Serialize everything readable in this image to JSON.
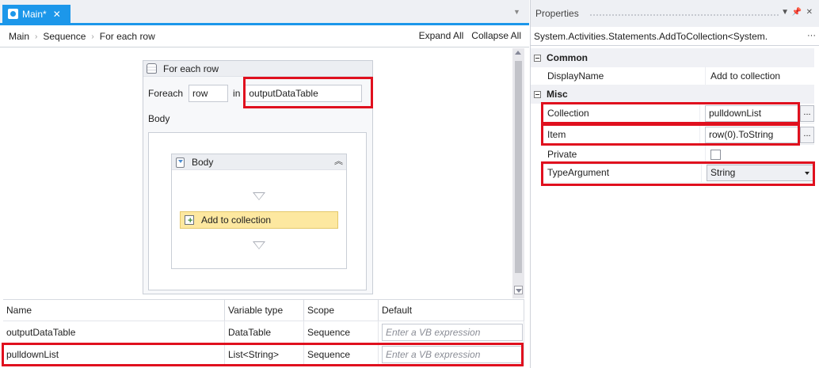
{
  "tab": {
    "label": "Main*",
    "close": "✕",
    "dropdown": "▼"
  },
  "breadcrumb": {
    "items": [
      "Main",
      "Sequence",
      "For each row"
    ],
    "separator": "›"
  },
  "toolbar": {
    "expand_all": "Expand All",
    "collapse_all": "Collapse All"
  },
  "foreach": {
    "title": "For each row",
    "foreach_label": "Foreach",
    "item_var": "row",
    "in_label": "in",
    "collection": "outputDataTable",
    "body_label": "Body"
  },
  "body_sequence": {
    "title": "Body",
    "collapse_glyph": "︽"
  },
  "activity": {
    "label": "Add to collection"
  },
  "variables": {
    "headers": [
      "Name",
      "Variable type",
      "Scope",
      "Default"
    ],
    "rows": [
      {
        "name": "outputDataTable",
        "type": "DataTable",
        "scope": "Sequence",
        "default_placeholder": "Enter a VB expression"
      },
      {
        "name": "pulldownList",
        "type": "List<String>",
        "scope": "Sequence",
        "default_placeholder": "Enter a VB expression"
      }
    ]
  },
  "properties": {
    "panel_title": "Properties",
    "pin_glyph": "📌",
    "close_glyph": "✕",
    "dropdown_glyph": "▼",
    "type_name": "System.Activities.Statements.AddToCollection<System.",
    "type_more": "···",
    "categories": {
      "common": "Common",
      "misc": "Misc"
    },
    "common": [
      {
        "name": "DisplayName",
        "value": "Add to collection"
      }
    ],
    "misc": [
      {
        "name": "Collection",
        "value": "pulldownList"
      },
      {
        "name": "Item",
        "value": "row(0).ToString"
      },
      {
        "name": "Private",
        "value": false
      },
      {
        "name": "TypeArgument",
        "value": "String"
      }
    ],
    "ellipsis": "..."
  },
  "colors": {
    "accent": "#1c97ea",
    "highlight": "#e0101e",
    "activity_fill": "#fde8a0"
  }
}
